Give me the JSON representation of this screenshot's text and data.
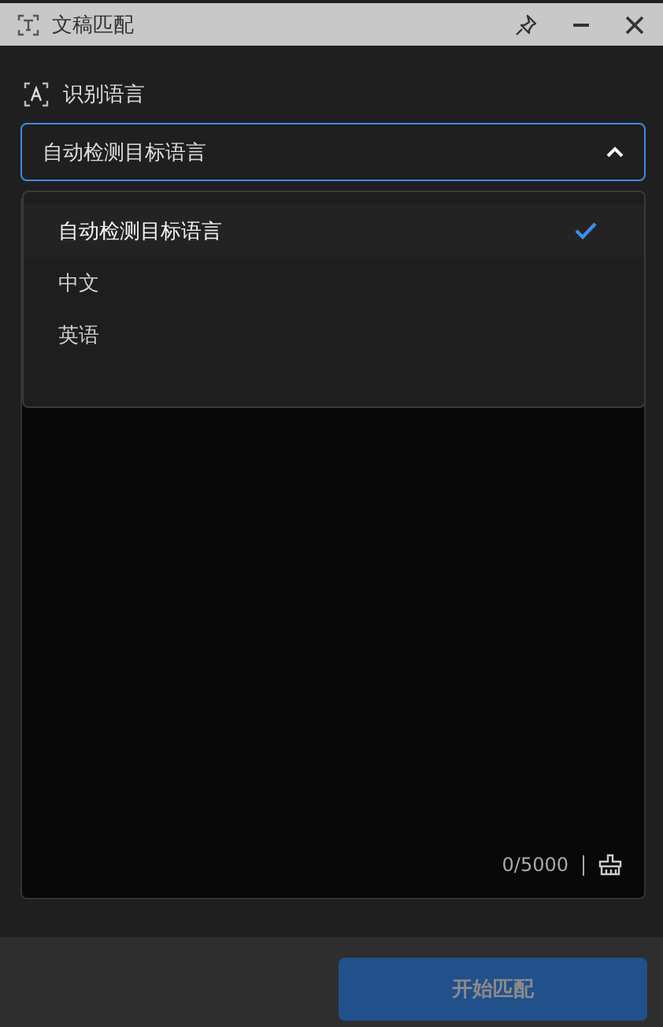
{
  "window": {
    "title": "文稿匹配"
  },
  "language": {
    "label": "识别语言",
    "value": "自动检测目标语言",
    "expanded": true,
    "options": [
      {
        "label": "自动检测目标语言",
        "selected": true
      },
      {
        "label": "中文",
        "selected": false
      },
      {
        "label": "英语",
        "selected": false
      }
    ]
  },
  "text_area": {
    "counter": "0/5000"
  },
  "start_button": {
    "label": "开始匹配",
    "disabled": true
  }
}
